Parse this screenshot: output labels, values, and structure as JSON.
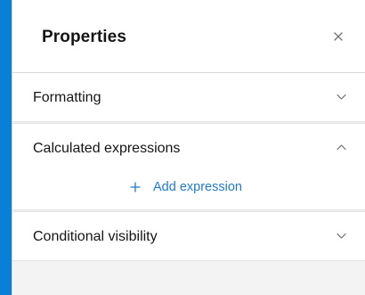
{
  "header": {
    "title": "Properties"
  },
  "sections": [
    {
      "label": "Formatting",
      "expanded": false
    },
    {
      "label": "Calculated expressions",
      "expanded": true,
      "action_label": "Add expression"
    },
    {
      "label": "Conditional visibility",
      "expanded": false
    }
  ],
  "colors": {
    "accent": "#0A7FD8",
    "link": "#1F7BC8",
    "panel_bg": "#F3F3F3",
    "card_bg": "#FFFFFF"
  },
  "icons": {
    "close": "close-icon",
    "expand": "chevron-down-icon",
    "collapse": "chevron-up-icon",
    "add": "plus-icon"
  }
}
